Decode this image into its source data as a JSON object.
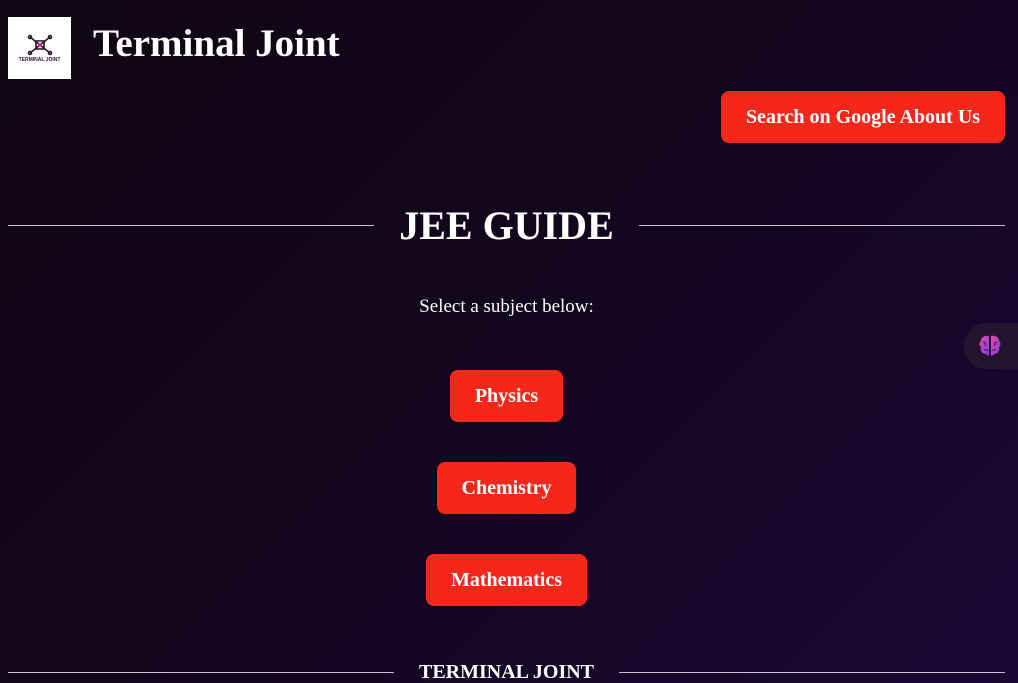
{
  "header": {
    "logo_text": "TERMINAL JOINT",
    "site_title": "Terminal Joint",
    "nav_button_label": "Search on Google About Us"
  },
  "main": {
    "title": "JEE GUIDE",
    "subtitle": "Select a subject below:",
    "subjects": [
      {
        "label": "Physics"
      },
      {
        "label": "Chemistry"
      },
      {
        "label": "Mathematics"
      }
    ]
  },
  "assistant": {
    "icon": "brain-icon"
  },
  "footer": {
    "label": "TERMINAL JOINT"
  },
  "colors": {
    "background": "#12061c",
    "accent": "#f5261a",
    "text": "#ffffff",
    "rule": "#c9c3d1"
  }
}
